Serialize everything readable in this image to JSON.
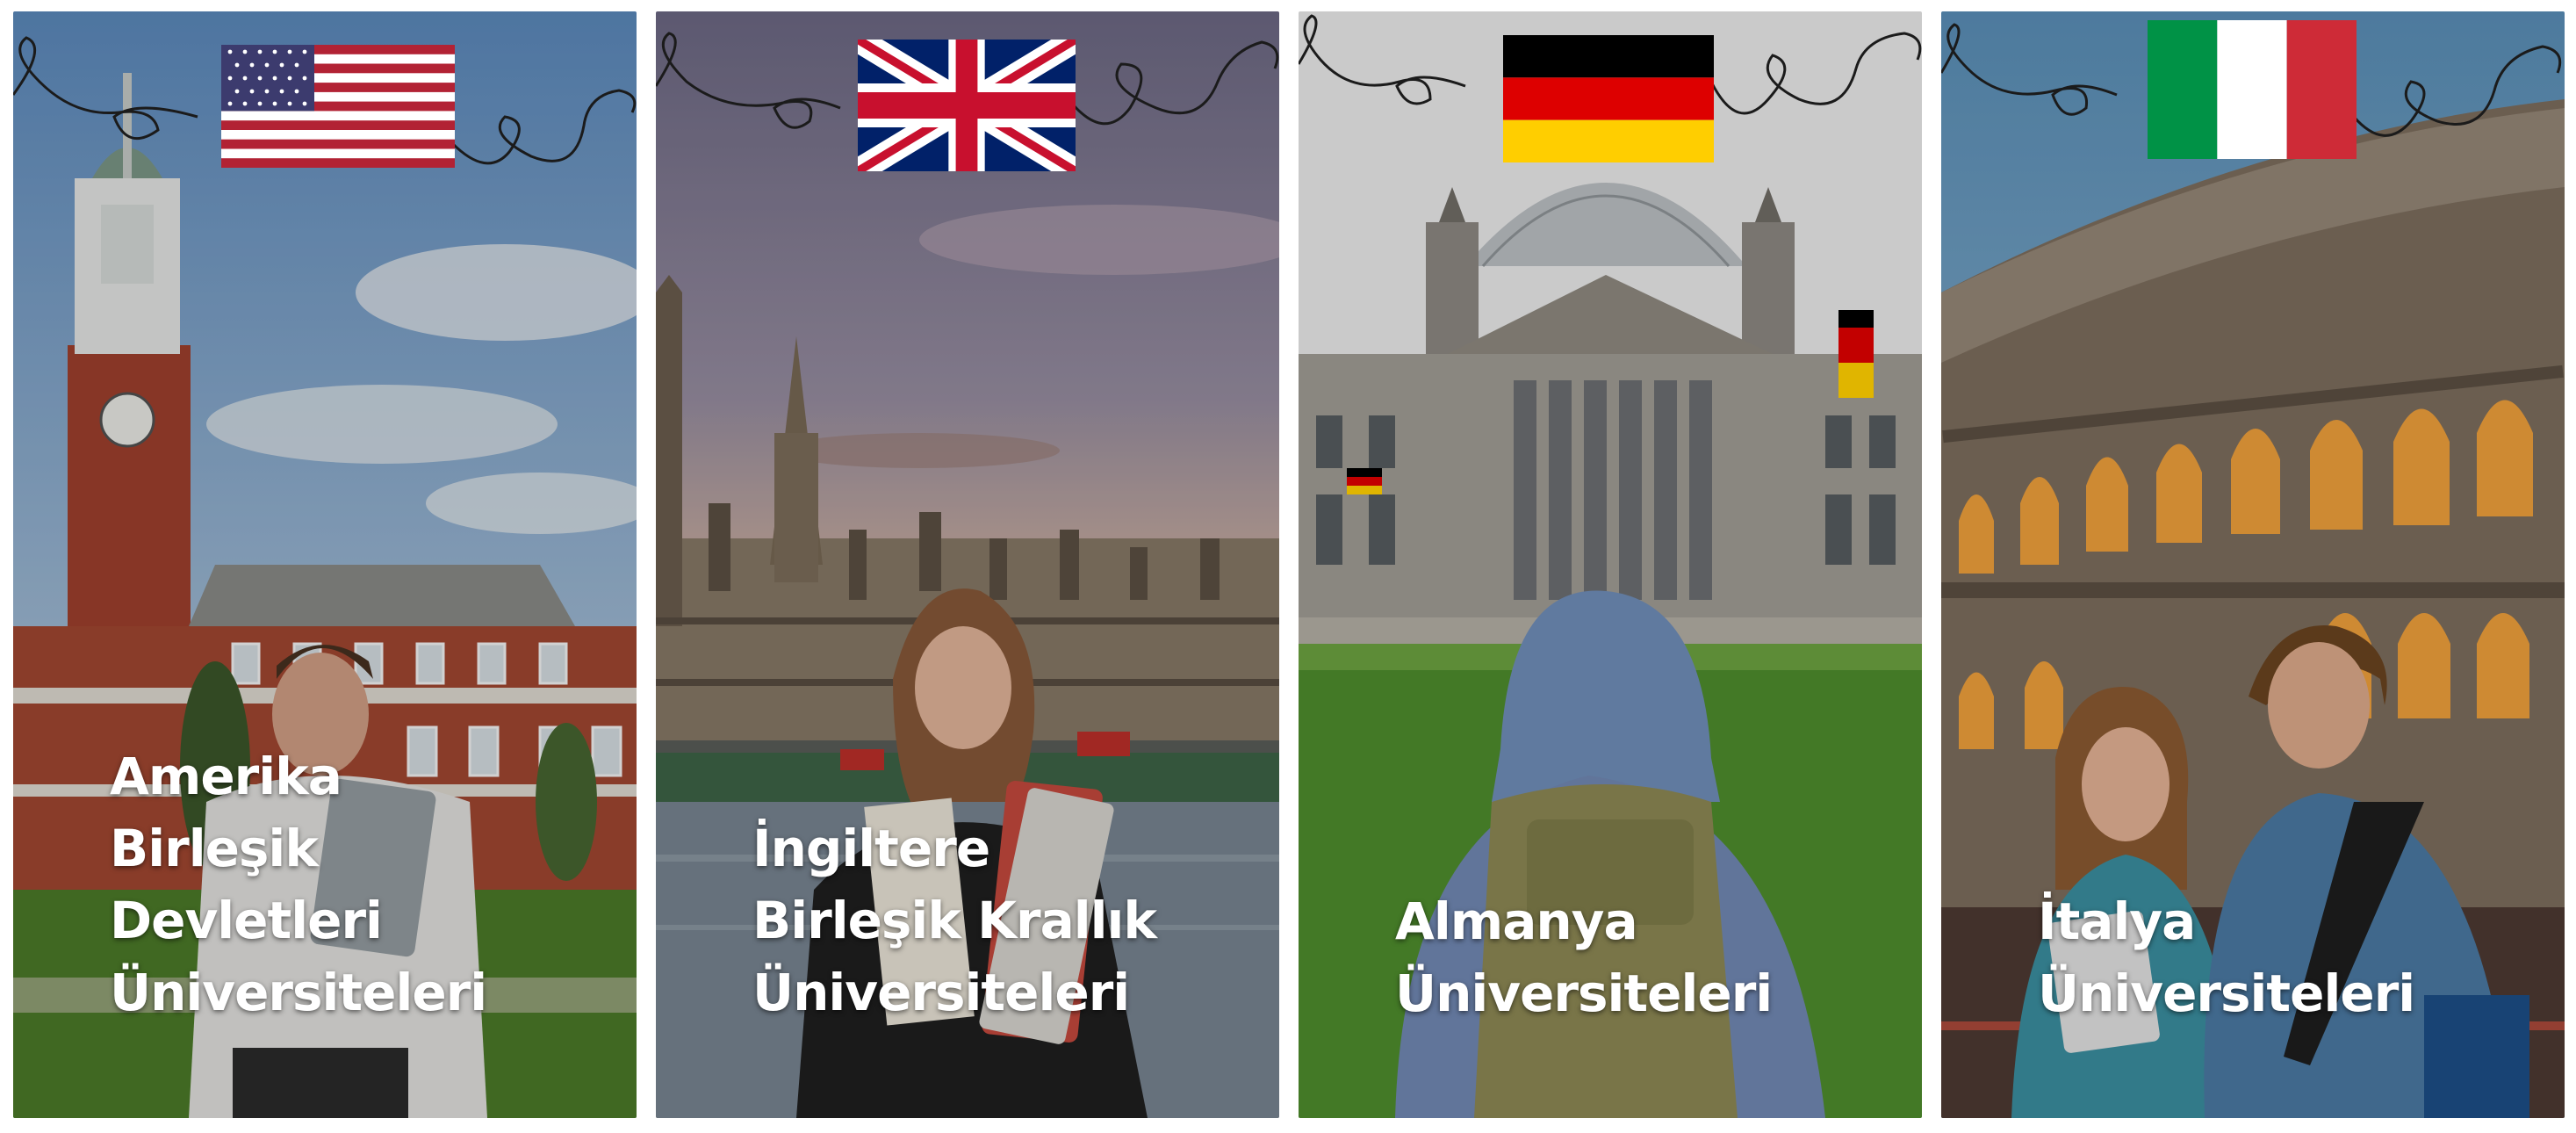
{
  "cards": [
    {
      "country": "usa",
      "flag_icon": "usa-flag-icon",
      "lines": [
        "Amerika",
        "Birleşik",
        "Devletleri",
        "Üniversiteleri"
      ]
    },
    {
      "country": "uk",
      "flag_icon": "uk-flag-icon",
      "lines": [
        "İngiltere",
        "Birleşik Krallık",
        "Üniversiteleri"
      ]
    },
    {
      "country": "germany",
      "flag_icon": "germany-flag-icon",
      "lines": [
        "Almanya",
        "Üniversiteleri"
      ]
    },
    {
      "country": "italy",
      "flag_icon": "italy-flag-icon",
      "lines": [
        "İtalya",
        "Üniversiteleri"
      ]
    }
  ],
  "colors": {
    "text": "#ffffff",
    "usa_red": "#b22234",
    "usa_blue": "#3c3b6e",
    "uk_blue": "#012169",
    "uk_red": "#c8102e",
    "de_black": "#000000",
    "de_red": "#dd0000",
    "de_gold": "#ffce00",
    "it_green": "#009246",
    "it_red": "#ce2b37"
  }
}
